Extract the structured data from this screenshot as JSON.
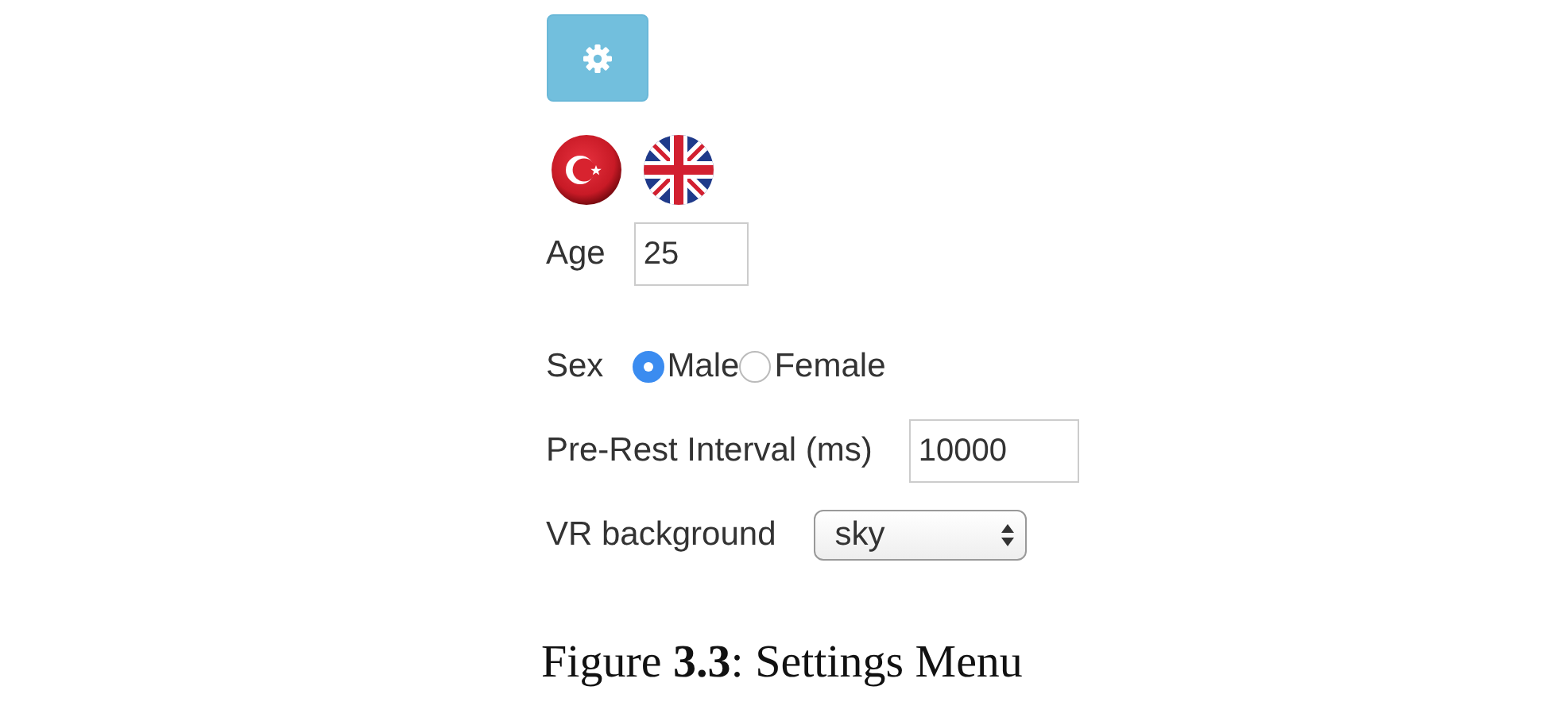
{
  "languages": [
    {
      "kind": "turkey"
    },
    {
      "kind": "uk"
    }
  ],
  "form": [
    {
      "kind": "text",
      "label": "Age",
      "value": "25"
    },
    {
      "kind": "radio",
      "label": "Sex",
      "options": [
        {
          "label": "Male",
          "selected": true
        },
        {
          "label": "Female",
          "selected": false
        }
      ]
    },
    {
      "kind": "text",
      "label": "Pre-Rest Interval (ms)",
      "value": "10000"
    },
    {
      "kind": "select",
      "label": "VR background",
      "value": "sky"
    }
  ],
  "caption": "Figure **3.3**: Settings Menu"
}
